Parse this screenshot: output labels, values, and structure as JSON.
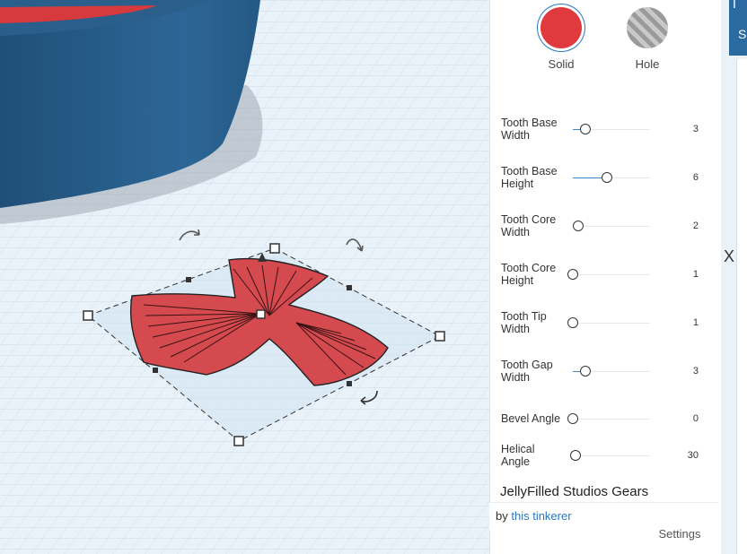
{
  "shape_mode": {
    "solid_label": "Solid",
    "hole_label": "Hole",
    "solid_color": "#e0393e",
    "selected": "Solid"
  },
  "parameters": [
    {
      "label": "Tooth Base Width",
      "value": "3",
      "fraction": 0.16
    },
    {
      "label": "Tooth Base Height",
      "value": "6",
      "fraction": 0.44
    },
    {
      "label": "Tooth Core Width",
      "value": "2",
      "fraction": 0.07
    },
    {
      "label": "Tooth Core Height",
      "value": "1",
      "fraction": 0.0
    },
    {
      "label": "Tooth Tip Width",
      "value": "1",
      "fraction": 0.0
    },
    {
      "label": "Tooth Gap Width",
      "value": "3",
      "fraction": 0.16
    },
    {
      "label": "Bevel Angle",
      "value": "0",
      "fraction": 0.0
    },
    {
      "label": "Helical Angle",
      "value": "30",
      "fraction": 0.03
    }
  ],
  "plugin": {
    "name": "JellyFilled Studios Gears",
    "author_prefix": "by",
    "author_link": "this tinkerer"
  },
  "footer": {
    "settings_label": "Settings"
  },
  "edge_fragments": {
    "top": "I",
    "second": "S",
    "mid": "X"
  }
}
